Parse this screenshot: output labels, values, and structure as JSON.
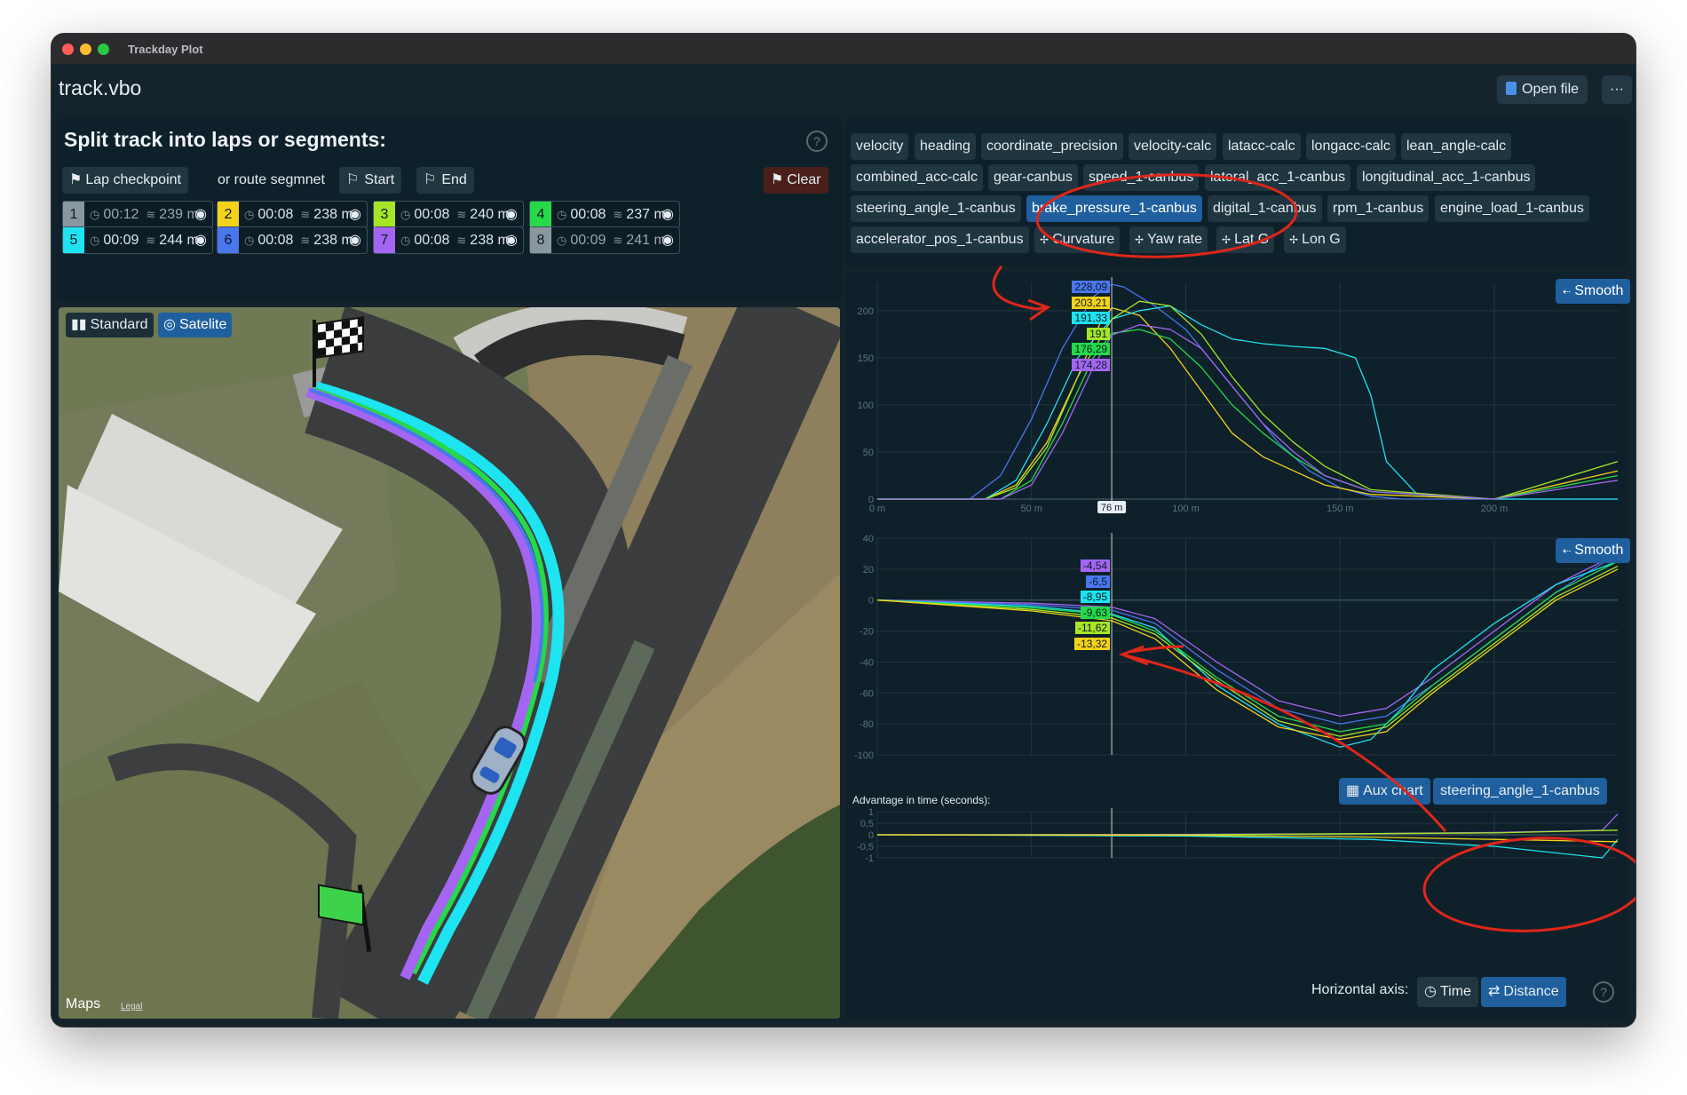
{
  "window": {
    "title": "Trackday Plot"
  },
  "header": {
    "file_name": "track.vbo",
    "open_file_label": "Open file",
    "more_label": "···"
  },
  "split_panel": {
    "title": "Split track into laps or segments:",
    "help": "?",
    "lap_checkpoint_label": "Lap checkpoint",
    "or_route_label": "or route segmnet",
    "start_label": "Start",
    "end_label": "End",
    "clear_label": "Clear",
    "laps": [
      {
        "num": "1",
        "time": "00:12",
        "dist": "239 m",
        "color": "#8a979e",
        "dim": true
      },
      {
        "num": "2",
        "time": "00:08",
        "dist": "238 m",
        "color": "#f4d21a",
        "dim": false
      },
      {
        "num": "3",
        "time": "00:08",
        "dist": "240 m",
        "color": "#a6e627",
        "dim": false
      },
      {
        "num": "4",
        "time": "00:08",
        "dist": "237 m",
        "color": "#26d94a",
        "dim": false
      },
      {
        "num": "5",
        "time": "00:09",
        "dist": "244 m",
        "color": "#1ee3f0",
        "dim": false
      },
      {
        "num": "6",
        "time": "00:08",
        "dist": "238 m",
        "color": "#4a77ee",
        "dim": false
      },
      {
        "num": "7",
        "time": "00:08",
        "dist": "238 m",
        "color": "#a466f2",
        "dim": false
      },
      {
        "num": "8",
        "time": "00:09",
        "dist": "241 m",
        "color": "#8a979e",
        "dim": true
      }
    ]
  },
  "map": {
    "standard_label": "Standard",
    "satellite_label": "Satelite",
    "maps_logo": "Maps",
    "legal": "Legal"
  },
  "channels": {
    "tags": [
      "velocity",
      "heading",
      "coordinate_precision",
      "velocity-calc",
      "latacc-calc",
      "longacc-calc",
      "lean_angle-calc",
      "combined_acc-calc",
      "gear-canbus",
      "speed_1-canbus",
      "lateral_acc_1-canbus",
      "longitudinal_acc_1-canbus",
      "steering_angle_1-canbus",
      "brake_pressure_1-canbus",
      "digital_1-canbus",
      "rpm_1-canbus",
      "engine_load_1-canbus",
      "accelerator_pos_1-canbus",
      "Curvature",
      "Yaw rate",
      "Lat G",
      "Lon G"
    ],
    "selected": "brake_pressure_1-canbus"
  },
  "chart1": {
    "smooth_label": "Smooth",
    "yticks": [
      "200",
      "150",
      "100",
      "50",
      "0"
    ],
    "xticks": [
      "0 m",
      "50 m",
      "100 m",
      "150 m",
      "200 m"
    ],
    "cursor_label": "76 m",
    "value_labels": [
      "228,09",
      "203,21",
      "191,33",
      "191",
      "176,29",
      "174,28"
    ],
    "value_colors": [
      "#4a77ee",
      "#f4d21a",
      "#1ee3f0",
      "#a6e627",
      "#26d94a",
      "#a466f2"
    ]
  },
  "chart2": {
    "smooth_label": "Smooth",
    "yticks": [
      "40",
      "20",
      "0",
      "-20",
      "-40",
      "-60",
      "-80",
      "-100"
    ],
    "value_labels": [
      "-4,54",
      "-6,5",
      "-8,95",
      "-9,63",
      "-11,62",
      "-13,32"
    ],
    "value_colors": [
      "#a466f2",
      "#4a77ee",
      "#1ee3f0",
      "#26d94a",
      "#a6e627",
      "#f4d21a"
    ]
  },
  "aux": {
    "aux_chart_label": "Aux chart",
    "aux_channel_label": "steering_angle_1-canbus",
    "advantage_label": "Advantage in time (seconds):",
    "yticks": [
      "1",
      "0,5",
      "0",
      "-0,5",
      "-1"
    ]
  },
  "footer": {
    "horizontal_axis_label": "Horizontal axis:",
    "time_label": "Time",
    "distance_label": "Distance",
    "help": "?"
  },
  "chart_data": [
    {
      "type": "line",
      "title": "",
      "xlabel": "",
      "ylabel": "",
      "xlim": [
        0,
        240
      ],
      "ylim": [
        0,
        230
      ],
      "series": [
        {
          "color": "#4a77ee",
          "x": [
            0,
            30,
            40,
            50,
            60,
            70,
            76,
            80,
            90,
            100,
            110,
            120,
            130,
            140,
            150,
            160,
            170,
            200,
            240
          ],
          "values": [
            0,
            0,
            25,
            85,
            160,
            215,
            228,
            225,
            205,
            180,
            140,
            100,
            60,
            30,
            12,
            3,
            0,
            0,
            0
          ]
        },
        {
          "color": "#f4d21a",
          "x": [
            0,
            35,
            45,
            55,
            65,
            72,
            76,
            85,
            95,
            105,
            115,
            125,
            135,
            145,
            160,
            200,
            240
          ],
          "values": [
            0,
            0,
            15,
            60,
            130,
            185,
            203,
            195,
            160,
            115,
            70,
            45,
            30,
            15,
            5,
            0,
            30
          ]
        },
        {
          "color": "#1ee3f0",
          "x": [
            0,
            35,
            45,
            55,
            65,
            76,
            85,
            95,
            105,
            115,
            125,
            135,
            145,
            155,
            160,
            165,
            175,
            200,
            240
          ],
          "values": [
            0,
            0,
            20,
            80,
            150,
            191,
            200,
            205,
            185,
            170,
            165,
            162,
            160,
            150,
            110,
            40,
            5,
            0,
            0
          ]
        },
        {
          "color": "#a6e627",
          "x": [
            0,
            35,
            45,
            55,
            65,
            76,
            85,
            95,
            105,
            115,
            125,
            135,
            145,
            160,
            200,
            240
          ],
          "values": [
            0,
            0,
            12,
            55,
            130,
            191,
            210,
            205,
            175,
            130,
            90,
            60,
            35,
            10,
            0,
            40
          ]
        },
        {
          "color": "#26d94a",
          "x": [
            0,
            40,
            50,
            60,
            70,
            76,
            85,
            95,
            105,
            115,
            125,
            135,
            145,
            160,
            200,
            240
          ],
          "values": [
            0,
            0,
            20,
            80,
            150,
            176,
            180,
            170,
            140,
            100,
            70,
            45,
            25,
            8,
            0,
            25
          ]
        },
        {
          "color": "#a466f2",
          "x": [
            0,
            40,
            50,
            60,
            70,
            76,
            85,
            95,
            105,
            115,
            125,
            135,
            145,
            160,
            200,
            240
          ],
          "values": [
            0,
            0,
            15,
            70,
            140,
            174,
            185,
            180,
            160,
            120,
            80,
            50,
            25,
            8,
            0,
            20
          ]
        }
      ]
    },
    {
      "type": "line",
      "title": "",
      "xlabel": "",
      "ylabel": "",
      "xlim": [
        0,
        240
      ],
      "ylim": [
        -100,
        40
      ],
      "series": [
        {
          "color": "#a466f2",
          "x": [
            0,
            50,
            76,
            90,
            110,
            130,
            150,
            165,
            180,
            200,
            220,
            240
          ],
          "values": [
            0,
            -2,
            -4.5,
            -12,
            -40,
            -65,
            -75,
            -70,
            -50,
            -20,
            10,
            30
          ]
        },
        {
          "color": "#4a77ee",
          "x": [
            0,
            50,
            76,
            90,
            110,
            130,
            150,
            165,
            180,
            200,
            220,
            240
          ],
          "values": [
            0,
            -3,
            -6.5,
            -15,
            -45,
            -70,
            -80,
            -75,
            -55,
            -25,
            5,
            30
          ]
        },
        {
          "color": "#1ee3f0",
          "x": [
            0,
            50,
            76,
            90,
            110,
            130,
            150,
            160,
            170,
            180,
            200,
            220,
            240
          ],
          "values": [
            0,
            -4,
            -9,
            -18,
            -55,
            -80,
            -95,
            -90,
            -70,
            -45,
            -15,
            10,
            25
          ]
        },
        {
          "color": "#26d94a",
          "x": [
            0,
            50,
            76,
            90,
            110,
            130,
            150,
            165,
            180,
            200,
            220,
            240
          ],
          "values": [
            0,
            -5,
            -9.6,
            -20,
            -50,
            -75,
            -85,
            -80,
            -55,
            -25,
            5,
            25
          ]
        },
        {
          "color": "#a6e627",
          "x": [
            0,
            50,
            76,
            90,
            110,
            130,
            150,
            165,
            180,
            200,
            220,
            240
          ],
          "values": [
            0,
            -6,
            -11.6,
            -22,
            -52,
            -78,
            -88,
            -82,
            -58,
            -28,
            2,
            22
          ]
        },
        {
          "color": "#f4d21a",
          "x": [
            0,
            50,
            76,
            90,
            110,
            130,
            150,
            165,
            180,
            200,
            220,
            240
          ],
          "values": [
            0,
            -7,
            -13.3,
            -25,
            -58,
            -82,
            -90,
            -85,
            -60,
            -30,
            0,
            20
          ]
        }
      ]
    },
    {
      "type": "line",
      "title": "Advantage in time (seconds):",
      "xlim": [
        0,
        240
      ],
      "ylim": [
        -1,
        1
      ],
      "series": [
        {
          "color": "#a466f2",
          "x": [
            0,
            100,
            160,
            200,
            235,
            240
          ],
          "values": [
            0,
            0.02,
            0.05,
            0.1,
            0.2,
            0.9
          ]
        },
        {
          "color": "#a6e627",
          "x": [
            0,
            100,
            160,
            200,
            240
          ],
          "values": [
            0,
            0,
            0.05,
            0.08,
            0.2
          ]
        },
        {
          "color": "#1ee3f0",
          "x": [
            0,
            100,
            160,
            200,
            235,
            240
          ],
          "values": [
            0,
            -0.05,
            -0.2,
            -0.5,
            -1.2,
            -0.2
          ]
        },
        {
          "color": "#f4d21a",
          "x": [
            0,
            100,
            160,
            200,
            240
          ],
          "values": [
            0,
            -0.02,
            -0.1,
            -0.2,
            -0.3
          ]
        }
      ]
    }
  ]
}
